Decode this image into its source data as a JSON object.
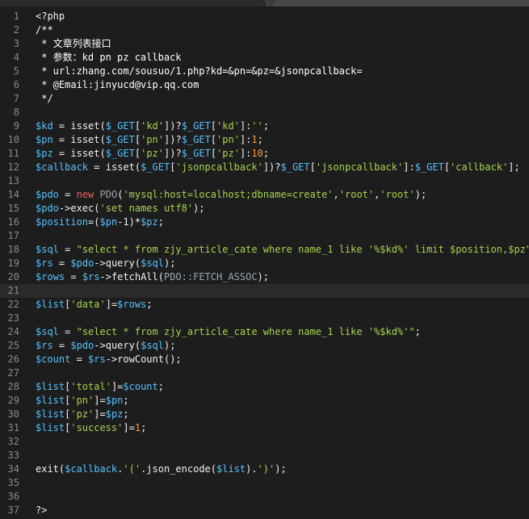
{
  "lines": [
    {
      "n": "1",
      "parts": [
        [
          "plain",
          "<?php"
        ]
      ]
    },
    {
      "n": "2",
      "parts": [
        [
          "com",
          "/**"
        ]
      ]
    },
    {
      "n": "3",
      "parts": [
        [
          "com",
          " * 文章列表接口"
        ]
      ]
    },
    {
      "n": "4",
      "parts": [
        [
          "com",
          " * 参数：kd pn pz callback"
        ]
      ]
    },
    {
      "n": "5",
      "parts": [
        [
          "com",
          " * url:zhang.com/sousuo/1.php?kd=&pn=&pz=&jsonpcallback="
        ]
      ]
    },
    {
      "n": "6",
      "parts": [
        [
          "com",
          " * @Email:jinyucd@vip.qq.com"
        ]
      ]
    },
    {
      "n": "7",
      "parts": [
        [
          "com",
          " */"
        ]
      ]
    },
    {
      "n": "8",
      "parts": []
    },
    {
      "n": "9",
      "parts": [
        [
          "var",
          "$kd"
        ],
        [
          "op",
          " = "
        ],
        [
          "fn",
          "isset("
        ],
        [
          "var",
          "$_GET"
        ],
        [
          "op",
          "["
        ],
        [
          "str",
          "'kd'"
        ],
        [
          "op",
          "])?"
        ],
        [
          "var",
          "$_GET"
        ],
        [
          "op",
          "["
        ],
        [
          "str",
          "'kd'"
        ],
        [
          "op",
          "]:"
        ],
        [
          "str",
          "''"
        ],
        [
          "op",
          ";"
        ]
      ]
    },
    {
      "n": "10",
      "parts": [
        [
          "var",
          "$pn"
        ],
        [
          "op",
          " = "
        ],
        [
          "fn",
          "isset("
        ],
        [
          "var",
          "$_GET"
        ],
        [
          "op",
          "["
        ],
        [
          "str",
          "'pn'"
        ],
        [
          "op",
          "])?"
        ],
        [
          "var",
          "$_GET"
        ],
        [
          "op",
          "["
        ],
        [
          "str",
          "'pn'"
        ],
        [
          "op",
          "]:"
        ],
        [
          "num",
          "1"
        ],
        [
          "op",
          ";"
        ]
      ]
    },
    {
      "n": "11",
      "parts": [
        [
          "var",
          "$pz"
        ],
        [
          "op",
          " = "
        ],
        [
          "fn",
          "isset("
        ],
        [
          "var",
          "$_GET"
        ],
        [
          "op",
          "["
        ],
        [
          "str",
          "'pz'"
        ],
        [
          "op",
          "])?"
        ],
        [
          "var",
          "$_GET"
        ],
        [
          "op",
          "["
        ],
        [
          "str",
          "'pz'"
        ],
        [
          "op",
          "]:"
        ],
        [
          "num",
          "10"
        ],
        [
          "op",
          ";"
        ]
      ]
    },
    {
      "n": "12",
      "parts": [
        [
          "var",
          "$callback"
        ],
        [
          "op",
          " = "
        ],
        [
          "fn",
          "isset("
        ],
        [
          "var",
          "$_GET"
        ],
        [
          "op",
          "["
        ],
        [
          "str",
          "'jsonpcallback'"
        ],
        [
          "op",
          "])?"
        ],
        [
          "var",
          "$_GET"
        ],
        [
          "op",
          "["
        ],
        [
          "str",
          "'jsonpcallback'"
        ],
        [
          "op",
          "]:"
        ],
        [
          "var",
          "$_GET"
        ],
        [
          "op",
          "["
        ],
        [
          "str",
          "'callback'"
        ],
        [
          "op",
          "];"
        ]
      ]
    },
    {
      "n": "13",
      "parts": []
    },
    {
      "n": "14",
      "parts": [
        [
          "var",
          "$pdo"
        ],
        [
          "op",
          " = "
        ],
        [
          "kw",
          "new"
        ],
        [
          "op",
          " "
        ],
        [
          "cls",
          "PDO"
        ],
        [
          "op",
          "("
        ],
        [
          "str",
          "'mysql:host=localhost;dbname=create'"
        ],
        [
          "op",
          ","
        ],
        [
          "str",
          "'root'"
        ],
        [
          "op",
          ","
        ],
        [
          "str",
          "'root'"
        ],
        [
          "op",
          ");"
        ]
      ]
    },
    {
      "n": "15",
      "parts": [
        [
          "var",
          "$pdo"
        ],
        [
          "op",
          "->"
        ],
        [
          "fn",
          "exec("
        ],
        [
          "str",
          "'set names utf8'"
        ],
        [
          "op",
          ");"
        ]
      ]
    },
    {
      "n": "16",
      "parts": [
        [
          "var",
          "$position"
        ],
        [
          "op",
          "=("
        ],
        [
          "var",
          "$pn"
        ],
        [
          "op",
          "-1)*"
        ],
        [
          "var",
          "$pz"
        ],
        [
          "op",
          ";"
        ]
      ]
    },
    {
      "n": "17",
      "parts": []
    },
    {
      "n": "18",
      "parts": [
        [
          "var",
          "$sql"
        ],
        [
          "op",
          " = "
        ],
        [
          "str",
          "\"select * from zjy_article_cate where name_1 like '%$kd%' limit $position,$pz\""
        ],
        [
          "op",
          ";"
        ]
      ]
    },
    {
      "n": "19",
      "parts": [
        [
          "var",
          "$rs"
        ],
        [
          "op",
          " = "
        ],
        [
          "var",
          "$pdo"
        ],
        [
          "op",
          "->"
        ],
        [
          "fn",
          "query("
        ],
        [
          "var",
          "$sql"
        ],
        [
          "op",
          ");"
        ]
      ]
    },
    {
      "n": "20",
      "parts": [
        [
          "var",
          "$rows"
        ],
        [
          "op",
          " = "
        ],
        [
          "var",
          "$rs"
        ],
        [
          "op",
          "->"
        ],
        [
          "fn",
          "fetchAll("
        ],
        [
          "cls",
          "PDO::FETCH_ASSOC"
        ],
        [
          "op",
          ");"
        ]
      ]
    },
    {
      "n": "21",
      "parts": [],
      "active": true
    },
    {
      "n": "22",
      "parts": [
        [
          "var",
          "$list"
        ],
        [
          "op",
          "["
        ],
        [
          "str",
          "'data'"
        ],
        [
          "op",
          "]="
        ],
        [
          "var",
          "$rows"
        ],
        [
          "op",
          ";"
        ]
      ]
    },
    {
      "n": "23",
      "parts": []
    },
    {
      "n": "24",
      "parts": [
        [
          "var",
          "$sql"
        ],
        [
          "op",
          " = "
        ],
        [
          "str",
          "\"select * from zjy_article_cate where name_1 like '%$kd%'\""
        ],
        [
          "op",
          ";"
        ]
      ]
    },
    {
      "n": "25",
      "parts": [
        [
          "var",
          "$rs"
        ],
        [
          "op",
          " = "
        ],
        [
          "var",
          "$pdo"
        ],
        [
          "op",
          "->"
        ],
        [
          "fn",
          "query("
        ],
        [
          "var",
          "$sql"
        ],
        [
          "op",
          ");"
        ]
      ]
    },
    {
      "n": "26",
      "parts": [
        [
          "var",
          "$count"
        ],
        [
          "op",
          " = "
        ],
        [
          "var",
          "$rs"
        ],
        [
          "op",
          "->"
        ],
        [
          "fn",
          "rowCount();"
        ]
      ]
    },
    {
      "n": "27",
      "parts": []
    },
    {
      "n": "28",
      "parts": [
        [
          "var",
          "$list"
        ],
        [
          "op",
          "["
        ],
        [
          "str",
          "'total'"
        ],
        [
          "op",
          "]="
        ],
        [
          "var",
          "$count"
        ],
        [
          "op",
          ";"
        ]
      ]
    },
    {
      "n": "29",
      "parts": [
        [
          "var",
          "$list"
        ],
        [
          "op",
          "["
        ],
        [
          "str",
          "'pn'"
        ],
        [
          "op",
          "]="
        ],
        [
          "var",
          "$pn"
        ],
        [
          "op",
          ";"
        ]
      ]
    },
    {
      "n": "30",
      "parts": [
        [
          "var",
          "$list"
        ],
        [
          "op",
          "["
        ],
        [
          "str",
          "'pz'"
        ],
        [
          "op",
          "]="
        ],
        [
          "var",
          "$pz"
        ],
        [
          "op",
          ";"
        ]
      ]
    },
    {
      "n": "31",
      "parts": [
        [
          "var",
          "$list"
        ],
        [
          "op",
          "["
        ],
        [
          "str",
          "'success'"
        ],
        [
          "op",
          "]="
        ],
        [
          "num",
          "1"
        ],
        [
          "op",
          ";"
        ]
      ]
    },
    {
      "n": "32",
      "parts": []
    },
    {
      "n": "33",
      "parts": []
    },
    {
      "n": "34",
      "parts": [
        [
          "fn",
          "exit("
        ],
        [
          "var",
          "$callback"
        ],
        [
          "op",
          "."
        ],
        [
          "str",
          "'('"
        ],
        [
          "op",
          ".json_encode("
        ],
        [
          "var",
          "$list"
        ],
        [
          "op",
          ")."
        ],
        [
          "str",
          "')'"
        ],
        [
          "op",
          ");"
        ]
      ]
    },
    {
      "n": "35",
      "parts": []
    },
    {
      "n": "36",
      "parts": []
    },
    {
      "n": "37",
      "parts": [
        [
          "plain",
          "?>"
        ]
      ]
    }
  ],
  "colors": {
    "background": "#1d1d1d",
    "variable": "#54c2ff",
    "string": "#a6d34f",
    "keyword": "#f06060",
    "number": "#f0a040"
  }
}
